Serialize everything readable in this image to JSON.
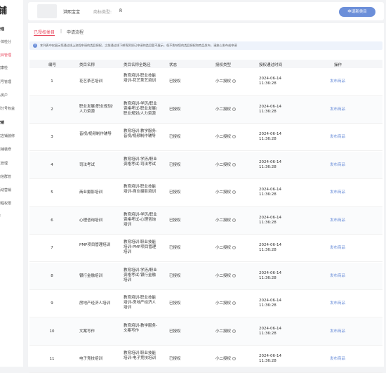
{
  "sidebar": {
    "logo": "铺",
    "items": [
      {
        "label": "管理",
        "group": true,
        "active": false
      },
      {
        "label": "身体检分",
        "group": false,
        "active": false
      },
      {
        "label": "类目管理",
        "group": false,
        "active": true
      },
      {
        "label": "健康检",
        "group": false,
        "active": false
      },
      {
        "label": "账号管理",
        "group": false,
        "active": false
      },
      {
        "label": "私房户",
        "group": false,
        "active": false
      },
      {
        "label": "部分号权益",
        "group": false,
        "active": false
      },
      {
        "label": "营销",
        "group": true,
        "active": false
      },
      {
        "label": "优店铺装修",
        "group": false,
        "active": false
      },
      {
        "label": "店铺装修",
        "group": false,
        "active": false
      },
      {
        "label": "主管理",
        "group": false,
        "active": false
      },
      {
        "label": "微信群管",
        "group": false,
        "active": false
      },
      {
        "label": "活动营销",
        "group": false,
        "active": false
      },
      {
        "label": "课程权限",
        "group": false,
        "active": false
      },
      {
        "label": "等",
        "group": false,
        "active": false
      }
    ]
  },
  "topbar": {
    "shop_name": "洪熙宝宝",
    "type_label": "商标类型:",
    "type_value": "R",
    "apply_button": "申请新类目"
  },
  "tabs": {
    "active": "已授权类目",
    "separator": "|",
    "other": "申请流程"
  },
  "notice": {
    "icon": "info-icon",
    "text": "本列表中仅展示您通过线上流程申请的类目授权，之前通过线下邮寄资质已申请的类目暂不展示，但不影响您的类目授权和商品发布，请放心发布或申请"
  },
  "table": {
    "headers": {
      "id": "编号",
      "name": "类目名称",
      "category": "类目名称全路径",
      "status": "状态",
      "auth_type": "授权类型",
      "time": "授权通过时间",
      "action": "操作"
    },
    "rows": [
      {
        "id": "1",
        "name": "花艺茶艺培训",
        "category": "教育培训-职业技能培训-花艺茶艺培训",
        "status": "已授权",
        "auth_type": "小二授权",
        "time": "2024-06-14 11:36:28",
        "action": "发布商品"
      },
      {
        "id": "2",
        "name": "职业发展/职业规划/人力资源",
        "category": "教育培训-学历/职业资格考试-职业发展/职业规划/人力资源",
        "status": "已授权",
        "auth_type": "小二授权",
        "time": "2024-06-14 11:36:28",
        "action": "发布商品"
      },
      {
        "id": "3",
        "name": "音视/视频制作辅导",
        "category": "教育培训-教学服务-音视/视频制作辅导",
        "status": "已授权",
        "auth_type": "小二授权",
        "time": "2024-06-14 11:36:28",
        "action": "发布商品"
      },
      {
        "id": "4",
        "name": "司法考试",
        "category": "教育培训-学历/职业资格考试-司法考试",
        "status": "已授权",
        "auth_type": "小二授权",
        "time": "2024-06-14 11:36:28",
        "action": "发布商品"
      },
      {
        "id": "5",
        "name": "商业摄影培训",
        "category": "教育培训-职业技能培训-商业摄影培训",
        "status": "已授权",
        "auth_type": "小二授权",
        "time": "2024-06-14 11:36:28",
        "action": "发布商品"
      },
      {
        "id": "6",
        "name": "心理咨询培训",
        "category": "教育培训-学历/职业资格考试-心理咨询培训",
        "status": "已授权",
        "auth_type": "小二授权",
        "time": "2024-06-14 11:36:28",
        "action": "发布商品"
      },
      {
        "id": "7",
        "name": "PMP项目管理培训",
        "category": "教育培训-职业技能培训-PMP项目管理培训",
        "status": "已授权",
        "auth_type": "小二授权",
        "time": "2024-06-14 11:36:28",
        "action": "发布商品"
      },
      {
        "id": "8",
        "name": "银行金融培训",
        "category": "教育培训-学历/职业资格考试-银行金融培训",
        "status": "已授权",
        "auth_type": "小二授权",
        "time": "2024-06-14 11:36:28",
        "action": "发布商品"
      },
      {
        "id": "9",
        "name": "房地产经济人培训",
        "category": "教育培训-职业技能培训-房地产经济人培训",
        "status": "已授权",
        "auth_type": "小二授权",
        "time": "2024-06-14 11:36:28",
        "action": "发布商品"
      },
      {
        "id": "10",
        "name": "文案写作",
        "category": "教育培训-教学服务-文案写作",
        "status": "已授权",
        "auth_type": "小二授权",
        "time": "2024-06-14 11:36:28",
        "action": "发布商品"
      },
      {
        "id": "11",
        "name": "电子竞技培训",
        "category": "教育培训-职业技能培训-电子竞技培训",
        "status": "已授权",
        "auth_type": "小二授权",
        "time": "2024-06-14 11:36:28",
        "action": "发布商品"
      }
    ]
  },
  "colors": {
    "accent": "#e84a5f",
    "primary": "#6c8fd9"
  }
}
